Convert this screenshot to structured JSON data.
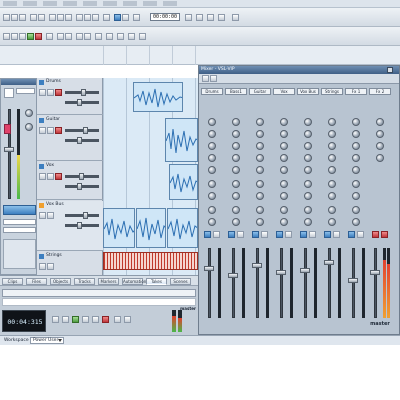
{
  "toolbar": {
    "time_display": "00:00:00"
  },
  "mixer": {
    "title": "Mixer - VSL-VIP",
    "channels": [
      {
        "name": "Drums"
      },
      {
        "name": "Bass1"
      },
      {
        "name": "Guitar"
      },
      {
        "name": "Vox"
      },
      {
        "name": "Vox Bus"
      },
      {
        "name": "Strings"
      },
      {
        "name": "Fx 1"
      },
      {
        "name": "Fx 2"
      }
    ],
    "master_label": "master"
  },
  "tracks": [
    {
      "name": "Drums"
    },
    {
      "name": "Guitar"
    },
    {
      "name": "Vox"
    },
    {
      "name": "Vox Bus"
    },
    {
      "name": "Strings"
    }
  ],
  "lower_panel": {
    "tabs": [
      "Clips",
      "Files",
      "Objects",
      "Tracks",
      "Markers",
      "Automation",
      "Takes",
      "Scenes"
    ],
    "transport_time": "00:04:315",
    "master_label": "master"
  },
  "workspace": {
    "label": "Workspace",
    "value": "Power User"
  },
  "colors": {
    "accent_blue": "#3d7fc0",
    "waveform": "#2c6fb2",
    "meter_red": "#e2402f",
    "selection_orange": "#f0a030"
  }
}
